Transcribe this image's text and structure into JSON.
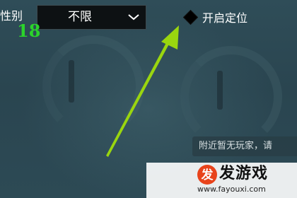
{
  "filters": {
    "gender_label": "性别",
    "gender_selected": "不限",
    "age_value": "18"
  },
  "location": {
    "label": "开启定位"
  },
  "notice": {
    "nearby_message": "附近暂无玩家，请"
  },
  "watermark": {
    "logo_char": "发",
    "name": "发游戏",
    "url": "www.fayouxi.com"
  },
  "colors": {
    "accent_arrow": "#9ad60f",
    "age_green": "#2bd32b",
    "watermark_logo": "#e8431b"
  }
}
